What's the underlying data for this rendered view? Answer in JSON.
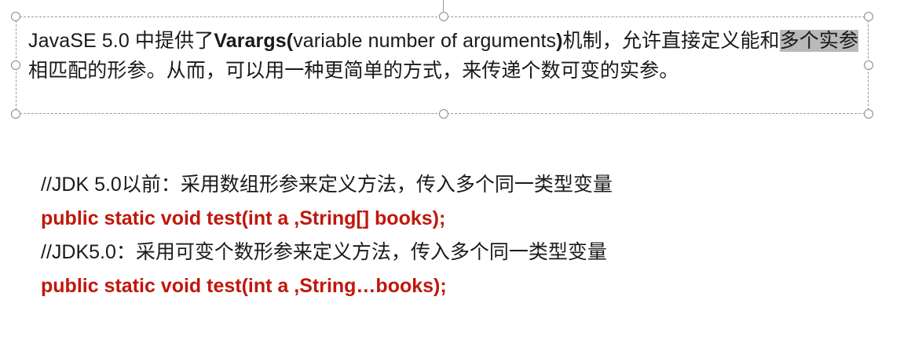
{
  "paragraph": {
    "part1": "JavaSE 5.0 中提供了",
    "bold1": "Varargs(",
    "part2": "variable number of arguments",
    "bold2": ")",
    "part3": "机制，允许直接定义能和",
    "highlight": "多个实参",
    "part4": "相匹配的形参。从而，可以用一种更简单的方式，来传递个数可变的实参。"
  },
  "code": {
    "comment1": "//JDK 5.0以前：采用数组形参来定义方法，传入多个同一类型变量",
    "signature1": "public static void test(int a ,String[] books);",
    "comment2": "//JDK5.0：采用可变个数形参来定义方法，传入多个同一类型变量",
    "signature2": "public static void test(int a ,String…books);"
  },
  "colors": {
    "code_signature": "#c0170c",
    "selection_highlight": "#b9b9b9",
    "handle_border": "#8a8a8a"
  }
}
